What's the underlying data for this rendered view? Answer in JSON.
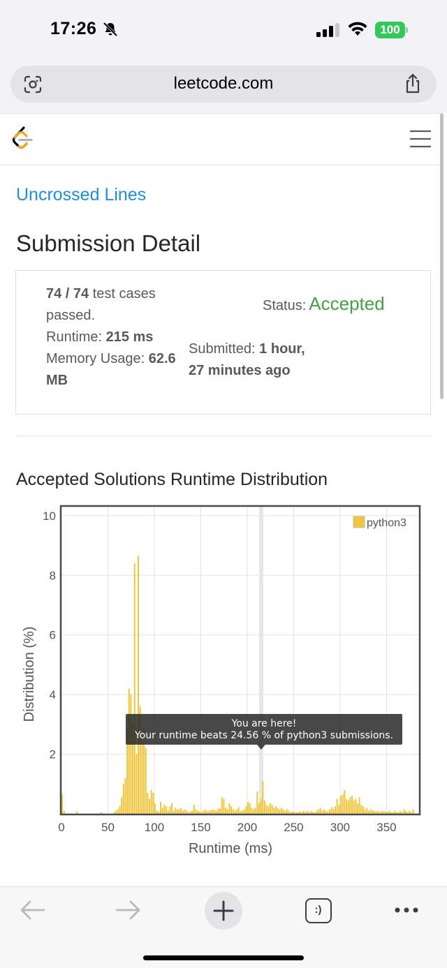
{
  "status_bar": {
    "time": "17:26",
    "battery": "100",
    "icons": [
      "bell-slash-icon",
      "cellular-signal-icon",
      "wifi-icon",
      "battery-icon"
    ]
  },
  "browser": {
    "url": "leetcode.com",
    "icons": [
      "camera-search-icon",
      "share-icon"
    ]
  },
  "header": {
    "logo": "leetcode-logo",
    "menu_icon": "hamburger-icon"
  },
  "problem": {
    "link": "Uncrossed Lines",
    "title": "Submission Detail"
  },
  "submission": {
    "cases_value": "74 / 74",
    "cases_suffix": " test cases",
    "cases_line2": "passed.",
    "runtime_label": "Runtime: ",
    "runtime_value": "215 ms",
    "memory_label": "Memory Usage: ",
    "memory_value_1": "62.6",
    "memory_value_2": "MB",
    "status_label": "Status:",
    "status_value": "Accepted",
    "status_color": "#43a047",
    "submitted_label": "Submitted: ",
    "submitted_value_1": "1 hour,",
    "submitted_value_2": "27 minutes ago"
  },
  "distribution_title": "Accepted Solutions Runtime Distribution",
  "chart_data": {
    "type": "bar",
    "xlabel": "Runtime (ms)",
    "ylabel": "Distribution (%)",
    "xlim": [
      0,
      385
    ],
    "ylim": [
      0,
      10.3
    ],
    "x_ticks": [
      "0",
      "50",
      "100",
      "150",
      "200",
      "250",
      "300",
      "350"
    ],
    "y_ticks": [
      "2",
      "4",
      "6",
      "8",
      "10"
    ],
    "grid": true,
    "legend": {
      "position": "top-right",
      "entries": [
        "python3"
      ]
    },
    "series": [
      {
        "name": "python3",
        "color": "#f0c63d",
        "bin_width": 2,
        "x": [
          0,
          2,
          16,
          42,
          56,
          58,
          60,
          62,
          64,
          66,
          68,
          70,
          72,
          74,
          76,
          78,
          80,
          82,
          84,
          86,
          88,
          90,
          92,
          94,
          96,
          98,
          100,
          102,
          104,
          106,
          108,
          110,
          112,
          114,
          116,
          118,
          120,
          122,
          124,
          126,
          128,
          130,
          132,
          134,
          136,
          138,
          140,
          142,
          144,
          146,
          148,
          150,
          152,
          154,
          156,
          158,
          160,
          162,
          164,
          166,
          168,
          170,
          172,
          174,
          176,
          178,
          180,
          182,
          184,
          186,
          188,
          190,
          192,
          194,
          196,
          198,
          200,
          202,
          204,
          206,
          208,
          210,
          212,
          214,
          216,
          218,
          220,
          222,
          224,
          226,
          228,
          230,
          232,
          234,
          236,
          238,
          240,
          242,
          244,
          246,
          248,
          250,
          252,
          254,
          256,
          258,
          260,
          262,
          264,
          266,
          268,
          270,
          272,
          274,
          276,
          278,
          280,
          282,
          284,
          286,
          288,
          290,
          292,
          294,
          296,
          298,
          300,
          302,
          304,
          306,
          308,
          310,
          312,
          314,
          316,
          318,
          320,
          322,
          324,
          326,
          328,
          330,
          332,
          334,
          336,
          338,
          340,
          342,
          344,
          346,
          348,
          350,
          352,
          354,
          356,
          358,
          360,
          362,
          364,
          366,
          368,
          370,
          372,
          374,
          376,
          378
        ],
        "values": [
          0.65,
          0.1,
          0.08,
          0.05,
          0.05,
          0.1,
          0.15,
          0.25,
          0.55,
          1.0,
          1.2,
          2.8,
          4.2,
          4.0,
          3.0,
          8.4,
          2.0,
          8.65,
          3.6,
          2.4,
          2.9,
          2.2,
          0.7,
          0.5,
          0.8,
          0.7,
          0.35,
          0.1,
          0.08,
          0.4,
          0.2,
          0.3,
          0.25,
          0.1,
          0.25,
          0.35,
          0.1,
          0.2,
          0.15,
          0.15,
          0.2,
          0.1,
          0.15,
          0.1,
          0.05,
          0.08,
          0.1,
          0.3,
          0.15,
          0.1,
          0.08,
          0.05,
          0.1,
          0.15,
          0.1,
          0.1,
          0.12,
          0.15,
          0.12,
          0.1,
          0.18,
          0.18,
          0.55,
          0.5,
          0.2,
          0.15,
          0.35,
          0.25,
          0.15,
          0.1,
          0.15,
          0.22,
          0.1,
          0.1,
          0.15,
          0.25,
          0.4,
          0.35,
          0.2,
          0.15,
          0.2,
          0.75,
          0.35,
          0.5,
          1.1,
          0.45,
          0.3,
          0.25,
          0.35,
          0.3,
          0.2,
          0.25,
          0.2,
          0.15,
          0.2,
          0.15,
          0.1,
          0.15,
          0.1,
          0.05,
          0.08,
          0.05,
          0.05,
          0.05,
          0.08,
          0.05,
          0.1,
          0.05,
          0.1,
          0.05,
          0.1,
          0.05,
          0.05,
          0.1,
          0.15,
          0.2,
          0.1,
          0.15,
          0.1,
          0.08,
          0.15,
          0.22,
          0.15,
          0.25,
          0.5,
          0.3,
          0.6,
          0.65,
          0.8,
          0.5,
          0.45,
          0.55,
          0.6,
          0.45,
          0.5,
          0.35,
          0.55,
          0.3,
          0.25,
          0.15,
          0.2,
          0.1,
          0.15,
          0.12,
          0.1,
          0.08,
          0.1,
          0.05,
          0.1,
          0.08,
          0.08,
          0.05,
          0.1,
          0.05,
          0.05,
          0.1,
          0.05,
          0.05,
          0.1,
          0.05,
          0.15,
          0.1,
          0.05,
          0.1,
          0.05,
          0.15
        ]
      }
    ],
    "highlight_x": 215,
    "tooltip": {
      "line1": "You are here!",
      "line2": "Your runtime beats 24.56 % of python3 submissions."
    }
  },
  "toolbar": {
    "icons": [
      "back-icon",
      "forward-icon",
      "new-tab-icon",
      "tabs-icon",
      "more-icon"
    ],
    "tabs_label": ":)"
  }
}
